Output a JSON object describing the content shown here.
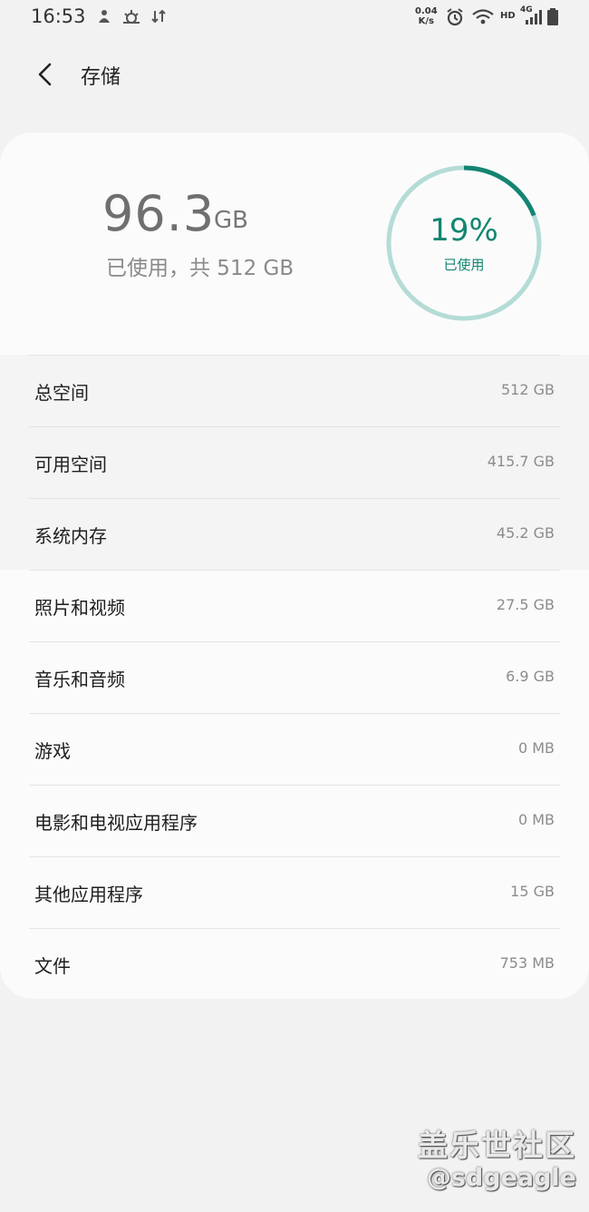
{
  "status_bar": {
    "time": "16:53",
    "net_speed_value": "0.04",
    "net_speed_unit": "K/s",
    "hd": "HD",
    "network": "4G"
  },
  "header": {
    "title": "存储"
  },
  "summary": {
    "used_value": "96.3",
    "used_unit": "GB",
    "subtitle": "已使用，共 512 GB",
    "percent_text": "19%",
    "percent_label": "已使用",
    "percent_fraction": 0.19,
    "accent_color": "#138571",
    "ring_track_color": "#b4dcd6"
  },
  "rows": [
    {
      "label": "总空间",
      "value": "512 GB"
    },
    {
      "label": "可用空间",
      "value": "415.7 GB"
    },
    {
      "label": "系统内存",
      "value": "45.2 GB"
    },
    {
      "label": "照片和视频",
      "value": "27.5 GB"
    },
    {
      "label": "音乐和音频",
      "value": "6.9 GB"
    },
    {
      "label": "游戏",
      "value": "0 MB"
    },
    {
      "label": "电影和电视应用程序",
      "value": "0 MB"
    },
    {
      "label": "其他应用程序",
      "value": "15 GB"
    },
    {
      "label": "文件",
      "value": "753 MB"
    }
  ],
  "watermark": {
    "line1": "盖乐世社区",
    "line2": "@sdgeagle"
  }
}
